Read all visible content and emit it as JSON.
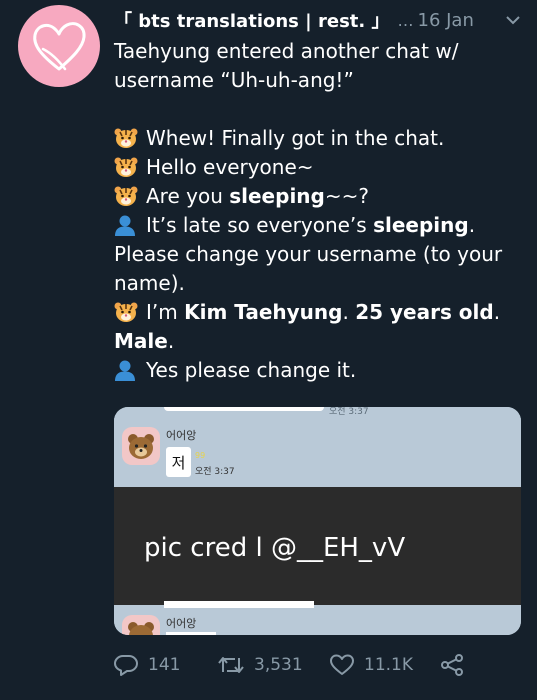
{
  "tweet": {
    "display_name": "「 bts translations | rest. 」",
    "separator": "…",
    "date": "16 Jan",
    "lines": {
      "intro_1": "Taehyung entered another chat w/",
      "intro_2": "username “Uh-uh-ang!”",
      "l1": "Whew! Finally got in the chat.",
      "l2": "Hello everyone~",
      "l3_a": "Are you ",
      "l3_b": "sleeping",
      "l3_c": "~~?",
      "l4_a": "It’s late so everyone’s ",
      "l4_b": "sleeping",
      "l4_c": ".",
      "l5": "Please change your username (to your name).",
      "l6_a": "I’m ",
      "l6_b": "Kim Taehyung",
      "l6_c": ". ",
      "l6_d": "25 years old",
      "l6_e": ".",
      "l7": "Male",
      "l7_c": ".",
      "l8": "Yes please change it."
    }
  },
  "media": {
    "nickname_1": "어어앙",
    "message": "저",
    "unread": "99",
    "time": "오전 3:37",
    "top_cut_time": "오전 3:37",
    "credit": "pic cred l @__EH_vV",
    "nickname_2": "어어앙"
  },
  "actions": {
    "replies": "141",
    "retweets": "3,531",
    "likes": "11.1K"
  },
  "colors": {
    "background": "#15202b",
    "muted": "#8899a6",
    "avatar": "#f7a9c0",
    "chat_bg": "#b9c9d7"
  }
}
